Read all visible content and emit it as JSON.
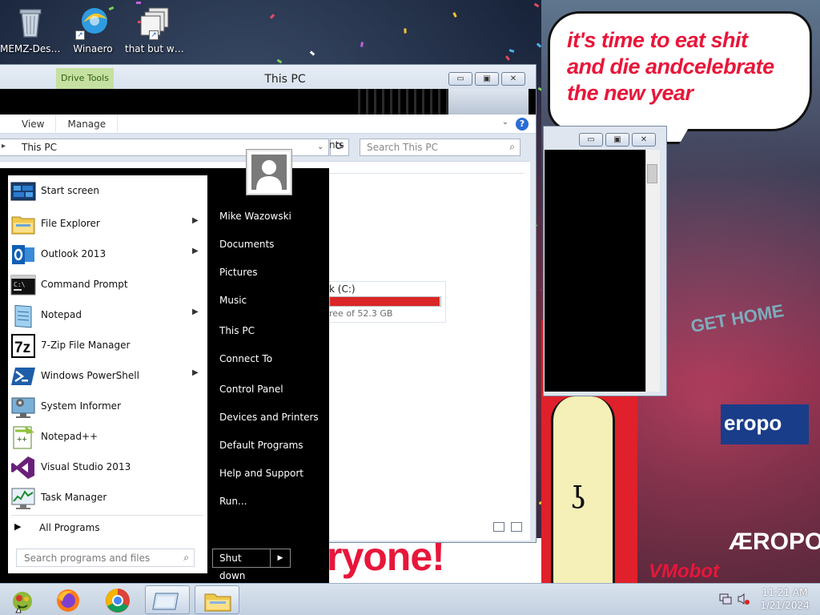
{
  "desktop": {
    "icons": [
      {
        "label": "MEMZ-Dest...",
        "icon": "recycle-bin-icon"
      },
      {
        "label": "Winaero",
        "icon": "winaero-icon"
      },
      {
        "label": "that but when",
        "icon": "stack-shortcut-icon"
      }
    ],
    "meme": {
      "bubble_lines": [
        "it's time to eat shit",
        "and die andcelebrate",
        "the new year"
      ],
      "sign_text": "GET HOME",
      "store_text": "eropo",
      "store_text_2": "ÆROPOS",
      "banner_text": "ryone!",
      "credit_text": "VMobot"
    }
  },
  "explorer": {
    "contextual_tab": "Drive Tools",
    "title": "This PC",
    "window_buttons": {
      "minimize": "▭",
      "maximize": "▣",
      "close": "✕"
    },
    "ribbon_tabs": [
      "View",
      "Manage"
    ],
    "help_label": "?",
    "address": "This PC",
    "search_placeholder": "Search This PC",
    "content": {
      "folder_fragment": "nts",
      "drive": {
        "name": "k (C:)",
        "free_text": "ree of 52.3 GB",
        "used_fraction": 0.99
      }
    }
  },
  "start_menu": {
    "programs": [
      {
        "label": "Start screen",
        "icon": "start-screen-icon",
        "submenu": false
      },
      {
        "label": "File Explorer",
        "icon": "file-explorer-icon",
        "submenu": true
      },
      {
        "label": "Outlook 2013",
        "icon": "outlook-icon",
        "submenu": true
      },
      {
        "label": "Command Prompt",
        "icon": "command-prompt-icon",
        "submenu": false
      },
      {
        "label": "Notepad",
        "icon": "notepad-icon",
        "submenu": true
      },
      {
        "label": "7-Zip File Manager",
        "icon": "7zip-icon",
        "submenu": false
      },
      {
        "label": "Windows PowerShell",
        "icon": "powershell-icon",
        "submenu": true
      },
      {
        "label": "System Informer",
        "icon": "system-informer-icon",
        "submenu": false
      },
      {
        "label": "Notepad++",
        "icon": "notepad-plus-plus-icon",
        "submenu": false
      },
      {
        "label": "Visual Studio 2013",
        "icon": "visual-studio-icon",
        "submenu": false
      },
      {
        "label": "Task Manager",
        "icon": "task-manager-icon",
        "submenu": false
      }
    ],
    "all_programs": "All Programs",
    "search_placeholder": "Search programs and files",
    "right_links": [
      "Mike Wazowski",
      "Documents",
      "Pictures",
      "Music",
      "This PC",
      "Connect To",
      "Control Panel",
      "Devices and Printers",
      "Default Programs",
      "Help and Support",
      "Run..."
    ],
    "shutdown_label": "Shut down",
    "shutdown_arrow": "▶"
  },
  "taskbar": {
    "items": [
      {
        "name": "start-orb",
        "icon": "start-orb-icon",
        "active": false
      },
      {
        "name": "firefox",
        "icon": "firefox-icon",
        "active": false
      },
      {
        "name": "chrome",
        "icon": "chrome-icon",
        "active": false
      },
      {
        "name": "window",
        "icon": "window-icon",
        "active": true
      },
      {
        "name": "explorer",
        "icon": "folder-icon",
        "active": true
      }
    ],
    "time": "11:21 AM",
    "date": "1/21/2024"
  },
  "colors": {
    "accent": "#2a6bd6",
    "drive_bar": "#da2626",
    "meme_red": "#e8163a",
    "drive_tools": "#c5e0a0"
  }
}
